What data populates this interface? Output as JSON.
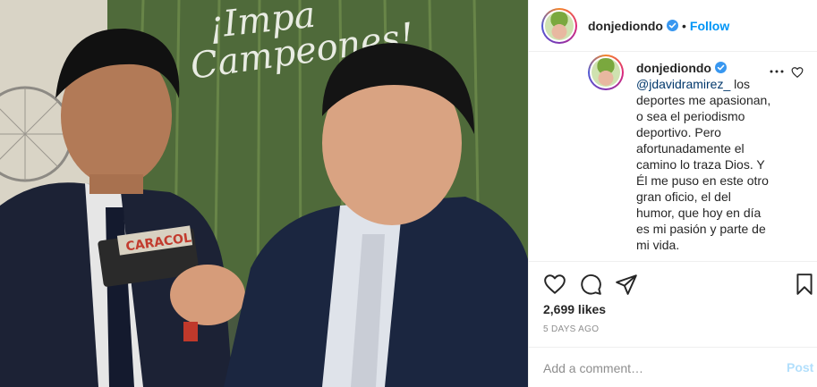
{
  "photo": {
    "banner_line1": "¡Impa",
    "banner_line2": "Campeones!",
    "mic_brand": "CARACOL"
  },
  "header": {
    "username": "donjediondo",
    "separator": "•",
    "follow_label": "Follow"
  },
  "caption": {
    "username": "donjediondo",
    "mention": "@jdavidramirez_",
    "text": " los deportes me apasionan, o sea el periodismo deportivo. Pero afortunadamente el camino lo traza Dios. Y Él me puso en este otro gran oficio, el del humor, que hoy en día es mi pasión y parte de mi vida."
  },
  "stats": {
    "likes": "2,699 likes",
    "time": "5 DAYS AGO"
  },
  "comment_box": {
    "placeholder": "Add a comment…",
    "post_label": "Post"
  },
  "colors": {
    "link": "#0095f6",
    "post_disabled": "#b2dffc",
    "verified": "#3897f0"
  },
  "icons": [
    "verified-icon",
    "more-options-icon",
    "heart-icon",
    "comment-icon",
    "share-icon",
    "bookmark-icon"
  ]
}
